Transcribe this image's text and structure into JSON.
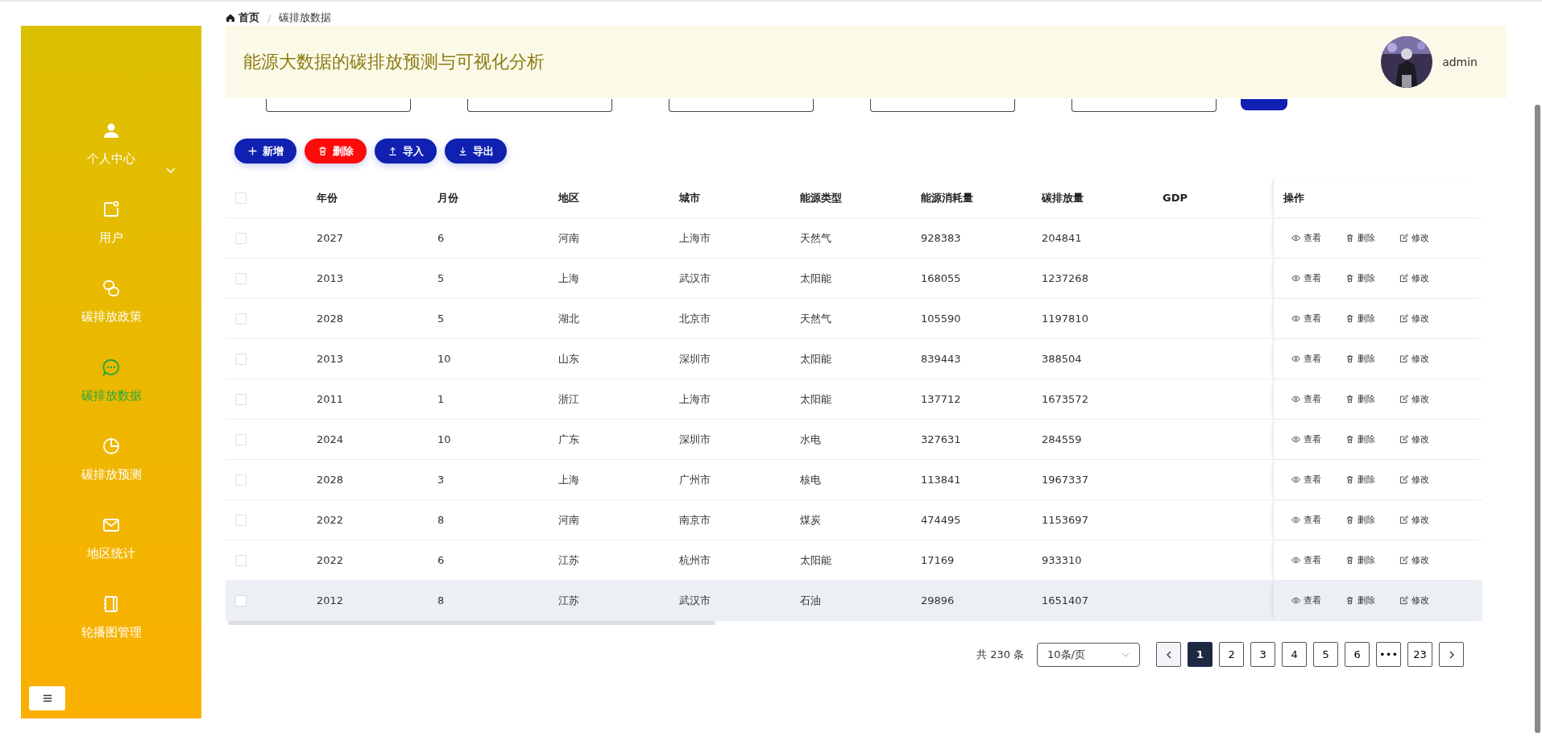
{
  "breadcrumb": [
    {
      "label": "首页",
      "kind": "home"
    },
    {
      "label": "碳排放数据",
      "kind": "current"
    }
  ],
  "breadcrumb_separator": "/",
  "header": {
    "title": "能源大数据的碳排放预测与可视化分析",
    "user": "admin"
  },
  "sidebar": {
    "items": [
      {
        "label": "个人中心",
        "kind": "user",
        "expandable": true,
        "selected": false
      },
      {
        "label": "用户",
        "kind": "note",
        "expandable": false,
        "selected": false
      },
      {
        "label": "碳排放政策",
        "kind": "link",
        "expandable": false,
        "selected": false
      },
      {
        "label": "碳排放数据",
        "kind": "chat",
        "expandable": false,
        "selected": true
      },
      {
        "label": "碳排放预测",
        "kind": "pie",
        "expandable": false,
        "selected": false
      },
      {
        "label": "地区统计",
        "kind": "mail",
        "expandable": false,
        "selected": false
      },
      {
        "label": "轮播图管理",
        "kind": "book",
        "expandable": false,
        "selected": false
      }
    ]
  },
  "toolbar": [
    {
      "label": "新增",
      "kind": "add"
    },
    {
      "label": "删除",
      "kind": "delete"
    },
    {
      "label": "导入",
      "kind": "import"
    },
    {
      "label": "导出",
      "kind": "export"
    }
  ],
  "table": {
    "select_all": {
      "checked": false
    },
    "columns": [
      "年份",
      "月份",
      "地区",
      "城市",
      "能源类型",
      "能源消耗量",
      "碳排放量",
      "GDP",
      "操作"
    ],
    "rows": [
      {
        "checked": false,
        "hovered": false,
        "cells": [
          "2027",
          "6",
          "河南",
          "上海市",
          "天然气",
          "928383",
          "204841"
        ],
        "actions": [
          "查看",
          "删除",
          "修改"
        ]
      },
      {
        "checked": false,
        "hovered": false,
        "cells": [
          "2013",
          "5",
          "上海",
          "武汉市",
          "太阳能",
          "168055",
          "1237268"
        ],
        "actions": [
          "查看",
          "删除",
          "修改"
        ]
      },
      {
        "checked": false,
        "hovered": false,
        "cells": [
          "2028",
          "5",
          "湖北",
          "北京市",
          "天然气",
          "105590",
          "1197810"
        ],
        "actions": [
          "查看",
          "删除",
          "修改"
        ]
      },
      {
        "checked": false,
        "hovered": false,
        "cells": [
          "2013",
          "10",
          "山东",
          "深圳市",
          "太阳能",
          "839443",
          "388504"
        ],
        "actions": [
          "查看",
          "删除",
          "修改"
        ]
      },
      {
        "checked": false,
        "hovered": false,
        "cells": [
          "2011",
          "1",
          "浙江",
          "上海市",
          "太阳能",
          "137712",
          "1673572"
        ],
        "actions": [
          "查看",
          "删除",
          "修改"
        ]
      },
      {
        "checked": false,
        "hovered": false,
        "cells": [
          "2024",
          "10",
          "广东",
          "深圳市",
          "水电",
          "327631",
          "284559"
        ],
        "actions": [
          "查看",
          "删除",
          "修改"
        ]
      },
      {
        "checked": false,
        "hovered": false,
        "cells": [
          "2028",
          "3",
          "上海",
          "广州市",
          "核电",
          "113841",
          "1967337"
        ],
        "actions": [
          "查看",
          "删除",
          "修改"
        ]
      },
      {
        "checked": false,
        "hovered": false,
        "cells": [
          "2022",
          "8",
          "河南",
          "南京市",
          "煤炭",
          "474495",
          "1153697"
        ],
        "actions": [
          "查看",
          "删除",
          "修改"
        ]
      },
      {
        "checked": false,
        "hovered": false,
        "cells": [
          "2022",
          "6",
          "江苏",
          "杭州市",
          "太阳能",
          "17169",
          "933310"
        ],
        "actions": [
          "查看",
          "删除",
          "修改"
        ]
      },
      {
        "checked": false,
        "hovered": true,
        "cells": [
          "2012",
          "8",
          "江苏",
          "武汉市",
          "石油",
          "29896",
          "1651407"
        ],
        "actions": [
          "查看",
          "删除",
          "修改"
        ]
      }
    ]
  },
  "pagination": {
    "total": "共 230 条",
    "page_size": "10条/页",
    "prev": {
      "disabled": true
    },
    "next": {
      "disabled": false
    },
    "pages": [
      {
        "label": "1",
        "selected": true
      },
      {
        "label": "2",
        "selected": false
      },
      {
        "label": "3",
        "selected": false
      },
      {
        "label": "4",
        "selected": false
      },
      {
        "label": "5",
        "selected": false
      },
      {
        "label": "6",
        "selected": false
      },
      {
        "label": "•••",
        "selected": false
      },
      {
        "label": "23",
        "selected": false
      }
    ]
  }
}
